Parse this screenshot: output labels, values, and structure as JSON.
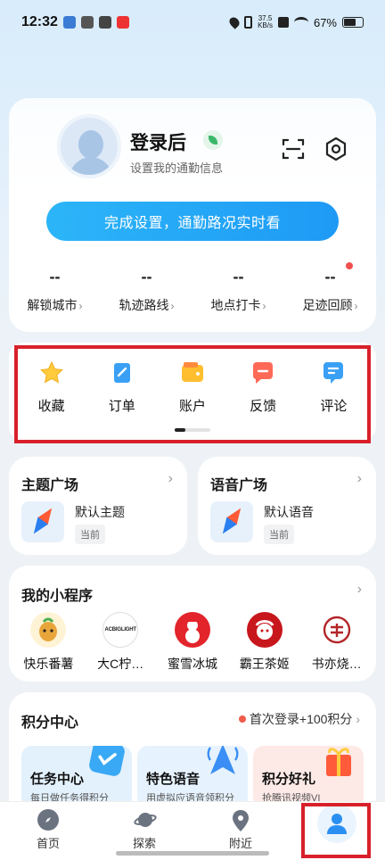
{
  "status_bar": {
    "time": "12:32",
    "speed_top": "37.5",
    "speed_bottom": "KB/s",
    "battery": "67%"
  },
  "profile": {
    "title": "登录后",
    "subtitle": "设置我的通勤信息",
    "cta": "完成设置，通勤路况实时看",
    "stats": [
      {
        "value": "--",
        "label": "解锁城市"
      },
      {
        "value": "--",
        "label": "轨迹路线"
      },
      {
        "value": "--",
        "label": "地点打卡"
      },
      {
        "value": "--",
        "label": "足迹回顾"
      }
    ]
  },
  "quick": {
    "items": [
      {
        "label": "收藏",
        "icon": "star-icon",
        "color": "#ffcb3d"
      },
      {
        "label": "订单",
        "icon": "order-icon",
        "color": "#3aa0f5"
      },
      {
        "label": "账户",
        "icon": "wallet-icon",
        "color": "#ffbe2e"
      },
      {
        "label": "反馈",
        "icon": "feedback-icon",
        "color": "#ff6a57"
      },
      {
        "label": "评论",
        "icon": "comment-icon",
        "color": "#3aa0f5"
      }
    ]
  },
  "theme": {
    "title": "主题广场",
    "name": "默认主题",
    "badge": "当前"
  },
  "voice": {
    "title": "语音广场",
    "name": "默认语音",
    "badge": "当前"
  },
  "mini_programs": {
    "title": "我的小程序",
    "items": [
      {
        "label": "快乐番薯",
        "logo_text": "",
        "bg": "#fff3d6",
        "fg": "#d8901e"
      },
      {
        "label": "大C柠…",
        "logo_text": "ACBIGLIGHT",
        "bg": "#ffffff",
        "fg": "#222222"
      },
      {
        "label": "蜜雪冰城",
        "logo_text": "",
        "bg": "#e3242b",
        "fg": "#ffffff"
      },
      {
        "label": "霸王茶姬",
        "logo_text": "",
        "bg": "#c8161d",
        "fg": "#ffffff"
      },
      {
        "label": "书亦烧…",
        "logo_text": "",
        "bg": "#ffffff",
        "fg": "#b3262a"
      }
    ]
  },
  "points": {
    "title": "积分中心",
    "promo": "首次登录+100积分",
    "tiles": [
      {
        "title": "任务中心",
        "sub": "每日做任务得积分",
        "bg": "#e3f1fd",
        "deco": "#3aa9f5"
      },
      {
        "title": "特色语音",
        "sub": "用虚拟应语音领积分",
        "bg": "#e6f2fd",
        "deco": "#3a8ef5"
      },
      {
        "title": "积分好礼",
        "sub": "抢腾讯视频VI",
        "bg": "#fde9e6",
        "deco": "#ff5a3a"
      }
    ]
  },
  "tabbar": {
    "tabs": [
      {
        "label": "首页",
        "icon": "compass-icon"
      },
      {
        "label": "探索",
        "icon": "planet-icon"
      },
      {
        "label": "附近",
        "icon": "location-pin-icon"
      },
      {
        "label": "",
        "icon": "person-icon"
      }
    ]
  }
}
